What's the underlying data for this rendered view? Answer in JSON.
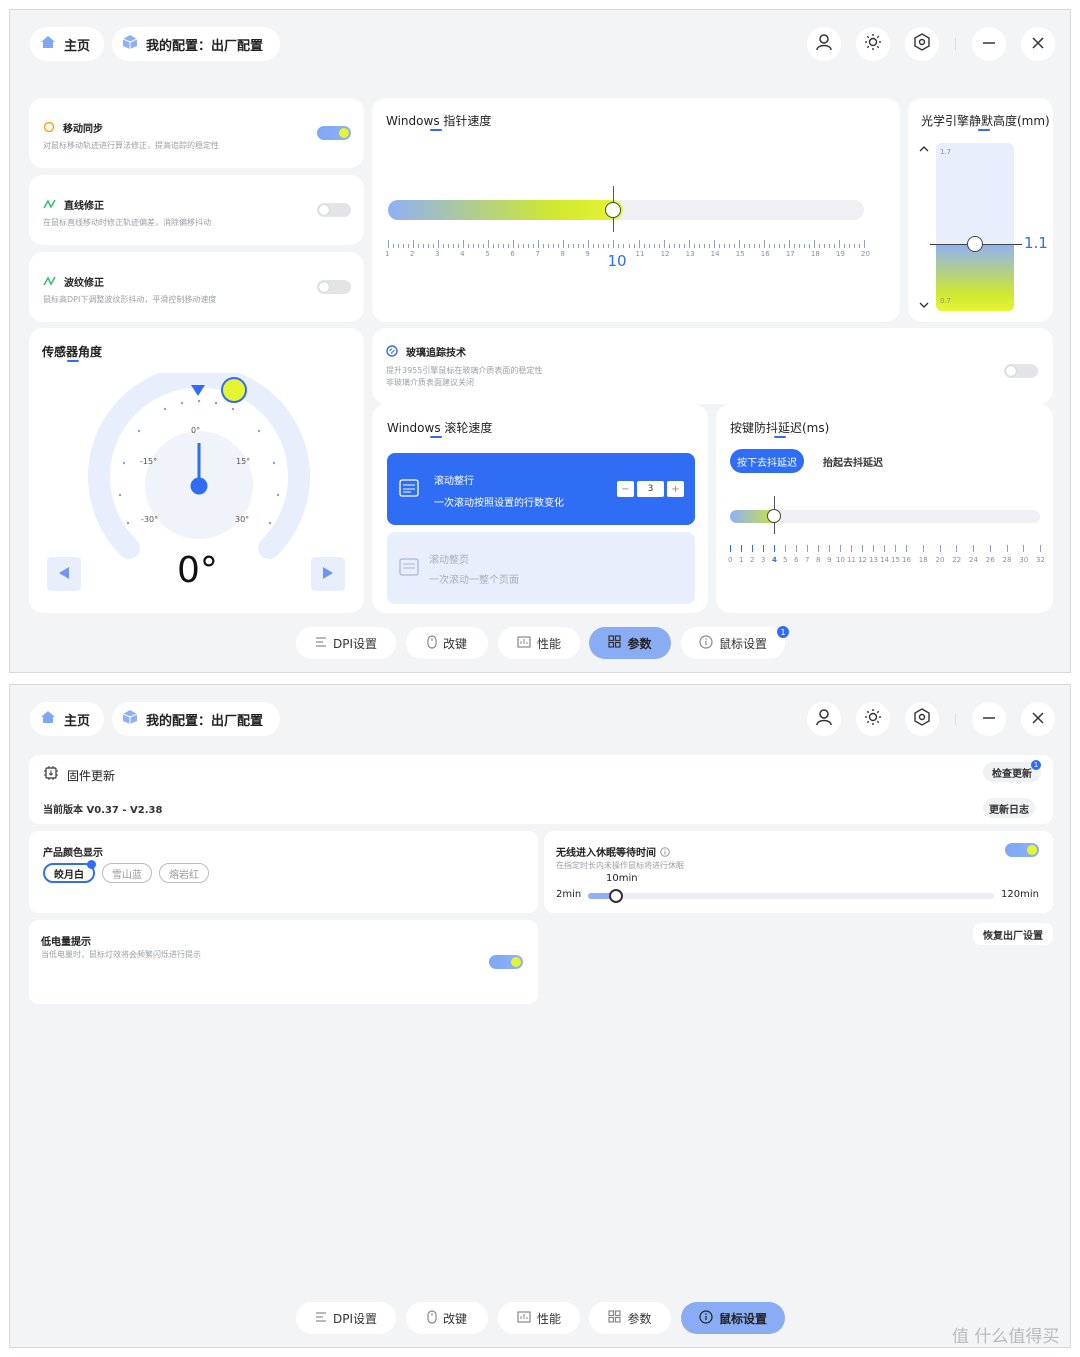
{
  "header": {
    "home_label": "主页",
    "config_label": "我的配置：出厂配置",
    "icons": [
      "user-icon",
      "brightness-icon",
      "hexagon-settings-icon",
      "minimize-icon",
      "close-icon"
    ]
  },
  "screen1": {
    "motion_sync": {
      "title": "移动同步",
      "desc": "对鼠标移动轨迹进行算法修正，提高追踪的稳定性",
      "enabled": true
    },
    "angle_snap": {
      "title": "直线修正",
      "desc": "在鼠标直线移动时修正轨迹偏差，消除偏移抖动",
      "enabled": false
    },
    "ripple": {
      "title": "波纹修正",
      "desc": "鼠标高DPI下调整波纹形抖动，平滑控制移动速度",
      "enabled": false
    },
    "pointer_speed": {
      "title": "Windows 指针速度",
      "value": 10,
      "value_label": "10",
      "min": 1,
      "max": 20,
      "ticks": [
        "1",
        "2",
        "3",
        "4",
        "5",
        "6",
        "7",
        "8",
        "9",
        "10",
        "11",
        "12",
        "13",
        "14",
        "15",
        "16",
        "17",
        "18",
        "19",
        "20"
      ]
    },
    "lod": {
      "title": "光学引擎静默高度(mm)",
      "top_label": "1.7",
      "bottom_label": "0.7",
      "value": 1.1,
      "value_label": "1.1",
      "min": 0.7,
      "max": 1.7
    },
    "sensor_angle": {
      "title": "传感器角度",
      "value_label": "0°",
      "dial_labels": {
        "zero": "0°",
        "neg15": "-15°",
        "pos15": "15°",
        "neg30": "-30°",
        "pos30": "30°"
      }
    },
    "glass": {
      "title": "玻璃追踪技术",
      "desc1": "提升3955引擎鼠标在玻璃介质表面的稳定性",
      "desc2": "非玻璃介质表面建议关闭",
      "enabled": false
    },
    "scroll": {
      "title": "Windows 滚轮速度",
      "opt1_title": "滚动整行",
      "opt1_desc": "一次滚动按照设置的行数变化",
      "lines": "3",
      "minus": "−",
      "plus": "+",
      "opt2_title": "滚动整页",
      "opt2_desc": "一次滚动一整个页面"
    },
    "debounce": {
      "title": "按键防抖延迟(ms)",
      "tab_press": "按下去抖延迟",
      "tab_release": "抬起去抖延迟",
      "value": 4,
      "highlight": "4",
      "ticks": [
        "0",
        "1",
        "2",
        "3",
        "4",
        "5",
        "6",
        "7",
        "8",
        "9",
        "10",
        "11",
        "12",
        "13",
        "14",
        "15",
        "16",
        "18",
        "20",
        "22",
        "24",
        "26",
        "28",
        "30",
        "32"
      ]
    },
    "active_tab": "参数"
  },
  "screen2": {
    "firmware": {
      "title": "固件更新",
      "version": "当前版本 V0.37 - V2.38",
      "check_btn": "检查更新",
      "badge": "1",
      "log_btn": "更新日志"
    },
    "color": {
      "title": "产品颜色显示",
      "options": [
        "皎月白",
        "雪山蓝",
        "熔岩红"
      ],
      "selected": "皎月白"
    },
    "sleep": {
      "title": "无线进入休眠等待时间",
      "desc": "在指定时长内未操作鼠标将进行休眠",
      "value_label": "10min",
      "min_label": "2min",
      "max_label": "120min",
      "value_min": 10
    },
    "reset_btn": "恢复出厂设置",
    "low_battery": {
      "title": "低电量提示",
      "desc": "当低电量时，鼠标灯效将会频繁闪烁进行提示",
      "enabled": true
    },
    "active_tab": "鼠标设置"
  },
  "bottom_nav": {
    "items": [
      "DPI设置",
      "改键",
      "性能",
      "参数",
      "鼠标设置"
    ],
    "badge": "1"
  },
  "watermark": "值 什么值得买"
}
